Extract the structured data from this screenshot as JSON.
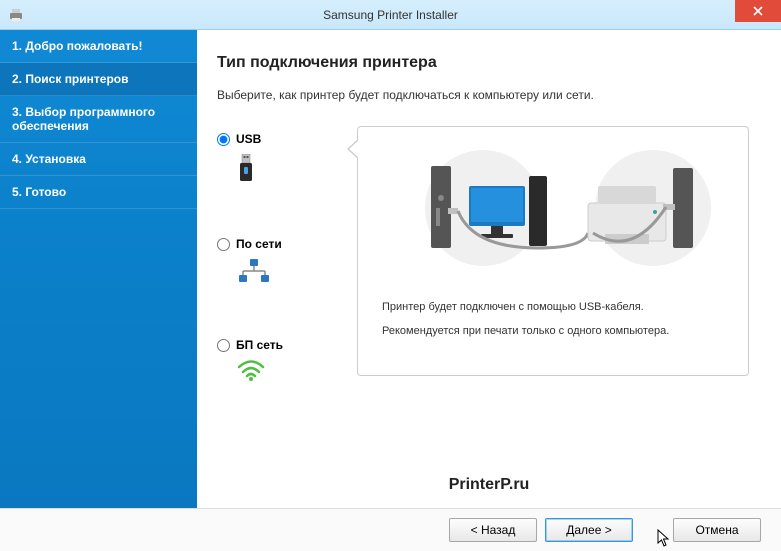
{
  "window": {
    "title": "Samsung Printer Installer"
  },
  "sidebar": {
    "items": [
      {
        "label": "1. Добро пожаловать!"
      },
      {
        "label": "2. Поиск принтеров"
      },
      {
        "label": "3. Выбор программного обеспечения"
      },
      {
        "label": "4. Установка"
      },
      {
        "label": "5. Готово"
      }
    ]
  },
  "main": {
    "heading": "Тип подключения принтера",
    "subtitle": "Выберите, как принтер будет подключаться к компьютеру или сети.",
    "options": {
      "usb": "USB",
      "network": "По сети",
      "wireless": "БП сеть"
    },
    "detail": {
      "line1": "Принтер будет подключен с помощью USB-кабеля.",
      "line2": "Рекомендуется при печати только с одного компьютера."
    },
    "watermark": "PrinterP.ru"
  },
  "footer": {
    "back": "< Назад",
    "next": "Далее >",
    "cancel": "Отмена"
  }
}
